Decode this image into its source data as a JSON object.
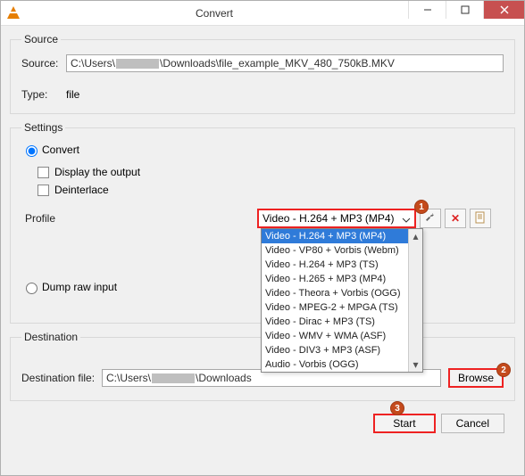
{
  "titlebar": {
    "title": "Convert"
  },
  "source_section": {
    "legend": "Source",
    "source_label": "Source:",
    "source_prefix": "C:\\Users\\",
    "source_suffix": "\\Downloads\\file_example_MKV_480_750kB.MKV",
    "type_label": "Type:",
    "type_value": "file"
  },
  "settings_section": {
    "legend": "Settings",
    "convert_label": "Convert",
    "display_output_label": "Display the output",
    "deinterlace_label": "Deinterlace",
    "profile_label": "Profile",
    "profile_selected": "Video - H.264 + MP3 (MP4)",
    "dump_label": "Dump raw input",
    "options": [
      "Video - H.264 + MP3 (MP4)",
      "Video - VP80 + Vorbis (Webm)",
      "Video - H.264 + MP3 (TS)",
      "Video - H.265 + MP3 (MP4)",
      "Video - Theora + Vorbis (OGG)",
      "Video - MPEG-2 + MPGA (TS)",
      "Video - Dirac + MP3 (TS)",
      "Video - WMV + WMA (ASF)",
      "Video - DIV3 + MP3 (ASF)",
      "Audio - Vorbis (OGG)"
    ]
  },
  "destination_section": {
    "legend": "Destination",
    "dest_label": "Destination file:",
    "dest_prefix": "C:\\Users\\",
    "dest_suffix": "\\Downloads",
    "browse_label": "Browse"
  },
  "buttons": {
    "start": "Start",
    "cancel": "Cancel"
  },
  "annotations": {
    "a1": "1",
    "a2": "2",
    "a3": "3"
  }
}
